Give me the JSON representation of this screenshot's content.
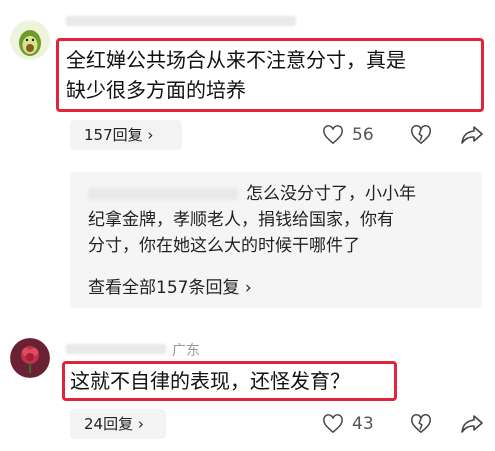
{
  "comment1": {
    "text_line1": "全红婵公共场合从来不注意分寸，真是",
    "text_line2": "缺少很多方面的培养",
    "replies_label": "157回复 ›",
    "likes": "56"
  },
  "reply_preview": {
    "text_line1": "怎么没分寸了，小小年",
    "text_line2": "纪拿金牌，孝顺老人，捐钱给国家，你有",
    "text_line3": "分寸，你在她这么大的时候干哪件了",
    "view_all": "查看全部157条回复 ›"
  },
  "comment2": {
    "location": "广东",
    "text": "这就不自律的表现，还怪发育？",
    "replies_label": "24回复 ›",
    "likes": "43"
  },
  "colors": {
    "highlight": "#e0243a",
    "pill_bg": "#f3f3f3"
  }
}
